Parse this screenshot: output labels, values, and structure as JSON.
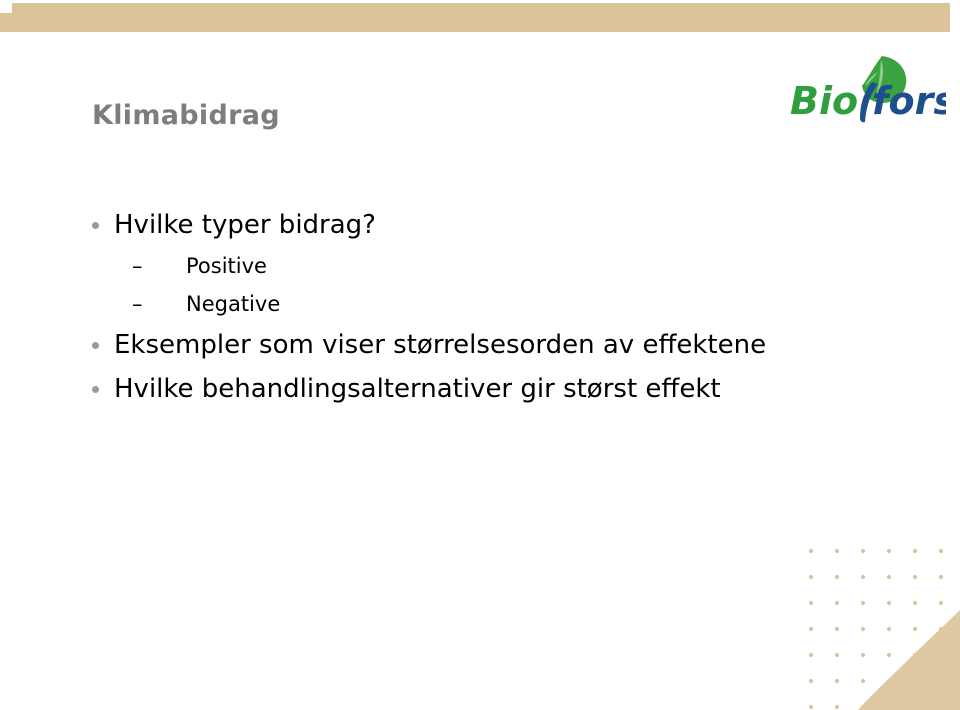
{
  "slide": {
    "title": "Klimabidrag",
    "title_color": "#7d7d7d",
    "background_color": "#ffffff"
  },
  "decoration": {
    "band_color": "#dcc49a",
    "dot_color": "#d8c49e",
    "swoosh_color": "#ddc9a3"
  },
  "logo": {
    "name": "bioforsk-logo",
    "text_part_1": "Bio",
    "text_part_2": "forsk",
    "color_part_1": "#2e9e3e",
    "color_part_2": "#1d4f8c",
    "leaf_color": "#3aa23f",
    "leaf_vein_color": "#7cc47e"
  },
  "content": {
    "bullets": [
      {
        "level": 1,
        "marker": "bullet-dot",
        "text": "Hvilke typer bidrag?"
      },
      {
        "level": 2,
        "marker": "–",
        "text": "Positive"
      },
      {
        "level": 2,
        "marker": "–",
        "text": "Negative"
      },
      {
        "level": 1,
        "marker": "bullet-dot",
        "text": "Eksempler som viser størrelsesorden av effektene"
      },
      {
        "level": 1,
        "marker": "bullet-dot",
        "text": "Hvilke behandlingsalternativer gir størst effekt"
      }
    ]
  }
}
